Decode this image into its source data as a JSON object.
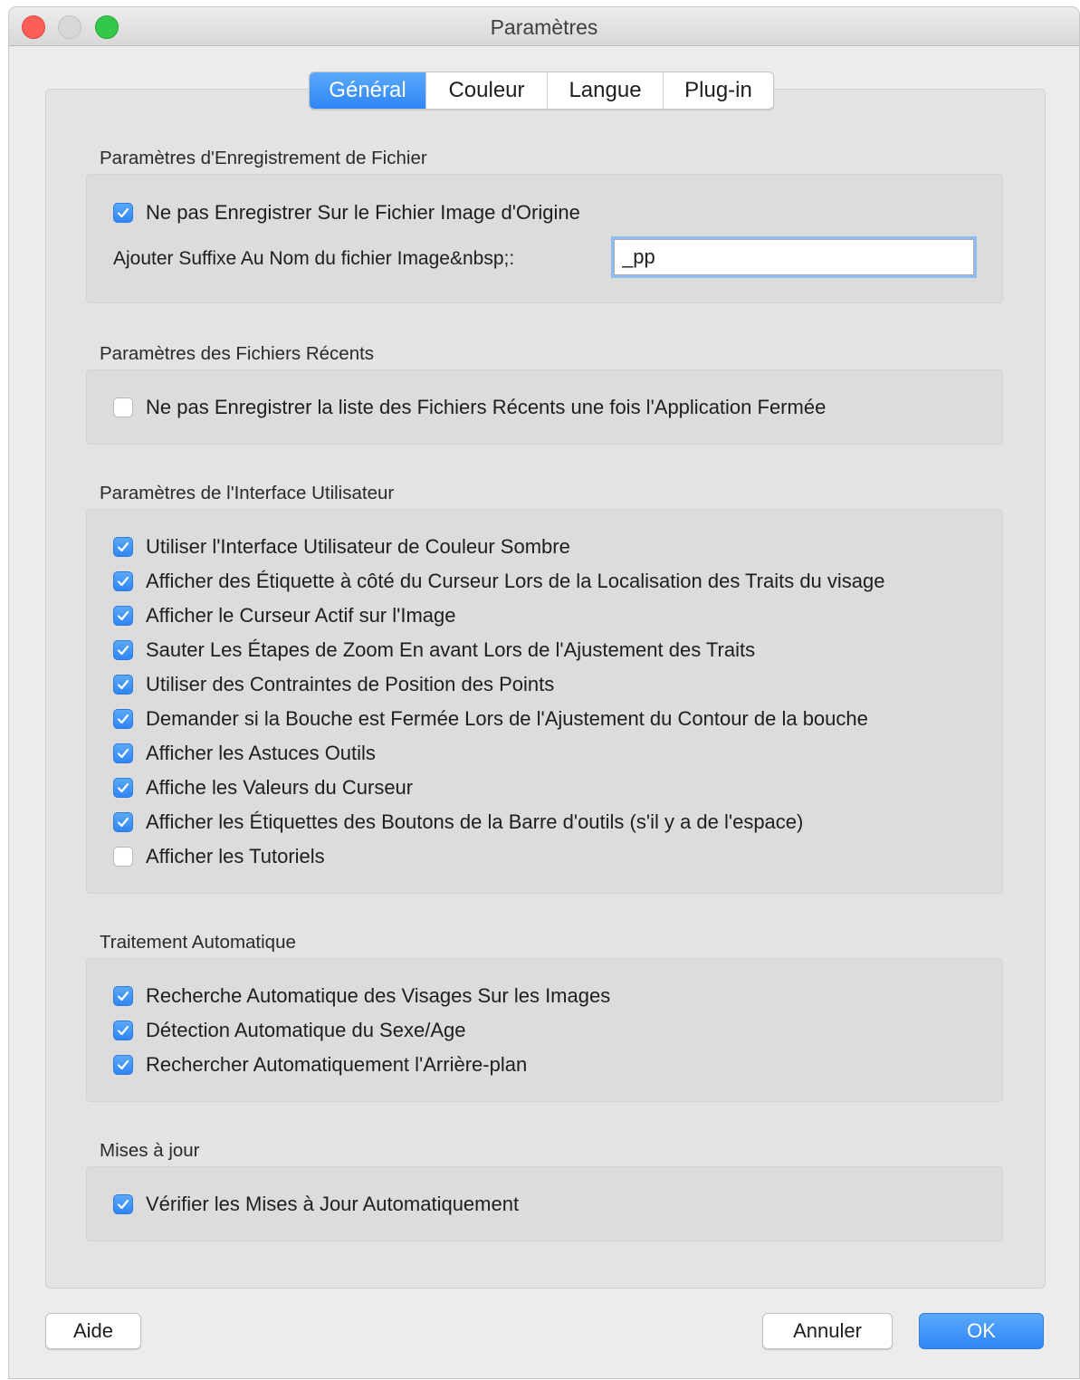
{
  "window": {
    "title": "Paramètres"
  },
  "tabs": [
    {
      "label": "Général",
      "active": true
    },
    {
      "label": "Couleur",
      "active": false
    },
    {
      "label": "Langue",
      "active": false
    },
    {
      "label": "Plug-in",
      "active": false
    }
  ],
  "sections": {
    "file_saving": {
      "title": "Paramètres d'Enregistrement de Fichier",
      "dont_overwrite": {
        "label": "Ne pas Enregistrer Sur le Fichier Image d'Origine",
        "checked": true
      },
      "suffix_label": "Ajouter Suffixe Au Nom du fichier Image&nbsp;:",
      "suffix_value": "_pp"
    },
    "recent_files": {
      "title": "Paramètres des Fichiers Récents",
      "dont_save_recent": {
        "label": "Ne pas Enregistrer la liste des Fichiers Récents une fois l'Application Fermée",
        "checked": false
      }
    },
    "ui": {
      "title": "Paramètres de l'Interface Utilisateur",
      "items": [
        {
          "label": "Utiliser l'Interface Utilisateur de Couleur Sombre",
          "checked": true
        },
        {
          "label": "Afficher des Étiquette à côté du Curseur Lors de la Localisation des Traits du visage",
          "checked": true
        },
        {
          "label": "Afficher le Curseur Actif sur l'Image",
          "checked": true
        },
        {
          "label": "Sauter Les Étapes de Zoom En avant Lors de l'Ajustement des Traits",
          "checked": true
        },
        {
          "label": "Utiliser des Contraintes de Position des Points",
          "checked": true
        },
        {
          "label": "Demander si la Bouche est Fermée Lors de l'Ajustement du Contour de la bouche",
          "checked": true
        },
        {
          "label": "Afficher les Astuces Outils",
          "checked": true
        },
        {
          "label": "Affiche les Valeurs du Curseur",
          "checked": true
        },
        {
          "label": "Afficher les Étiquettes des Boutons de la Barre d'outils (s'il y a de l'espace)",
          "checked": true
        },
        {
          "label": "Afficher les Tutoriels",
          "checked": false
        }
      ]
    },
    "auto_processing": {
      "title": "Traitement Automatique",
      "items": [
        {
          "label": "Recherche Automatique des Visages Sur les Images",
          "checked": true
        },
        {
          "label": "Détection Automatique du Sexe/Age",
          "checked": true
        },
        {
          "label": "Rechercher Automatiquement l'Arrière-plan",
          "checked": true
        }
      ]
    },
    "updates": {
      "title": "Mises à jour",
      "items": [
        {
          "label": "Vérifier les Mises à Jour Automatiquement",
          "checked": true
        }
      ]
    }
  },
  "buttons": {
    "help": "Aide",
    "cancel": "Annuler",
    "ok": "OK"
  },
  "colors": {
    "accent": "#2f86f5",
    "window_bg": "#ececec",
    "close": "#fc5f57",
    "zoom": "#34c84a"
  },
  "icons": {
    "checkbox_checked": "checkmark-icon"
  }
}
